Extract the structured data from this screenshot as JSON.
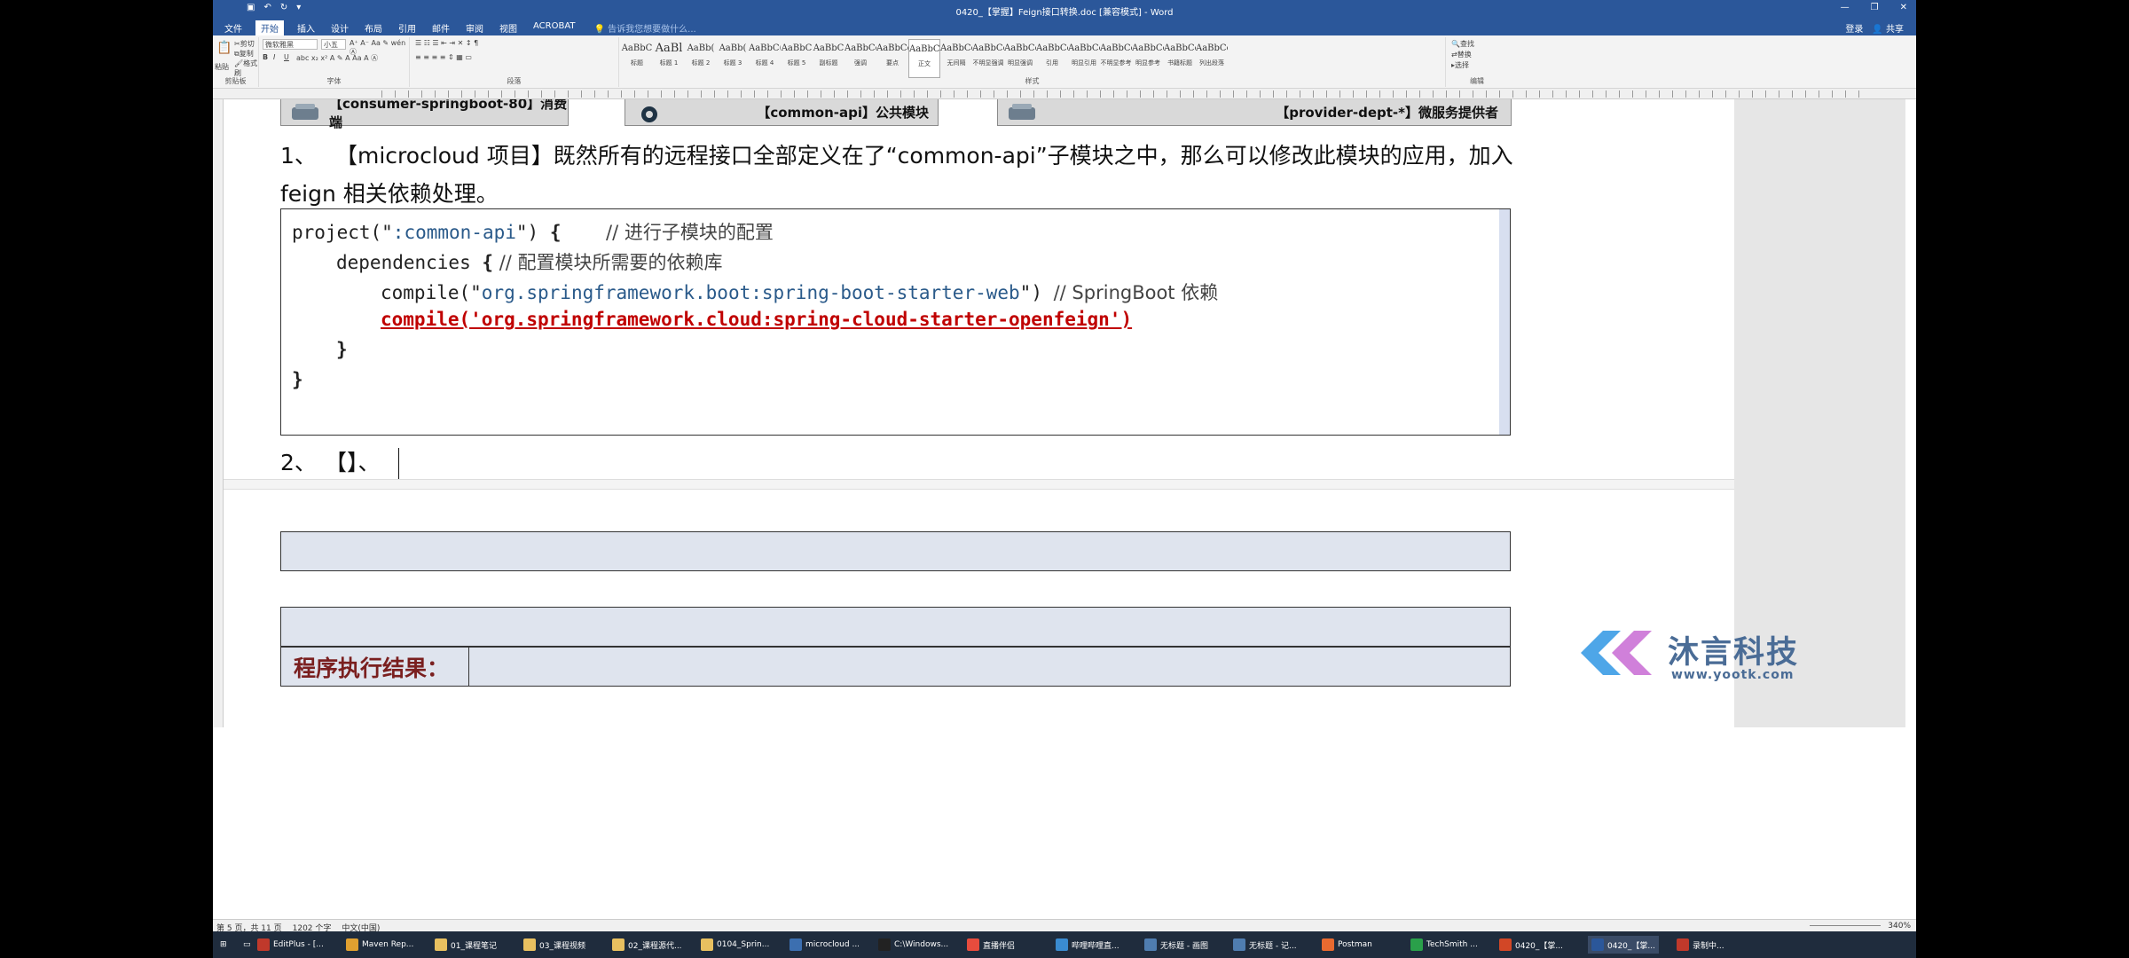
{
  "titlebar": {
    "title": "0420_【掌握】Feign接口转换.doc [兼容模式] - Word",
    "minimize": "—",
    "restore": "❐",
    "close": "✕"
  },
  "menu": {
    "tabs": [
      "文件",
      "开始",
      "插入",
      "设计",
      "布局",
      "引用",
      "邮件",
      "审阅",
      "视图",
      "ACROBAT"
    ],
    "active": "开始",
    "tellme": "告诉我您想要做什么...",
    "login": "登录",
    "share": "共享"
  },
  "ribbon": {
    "paste": "粘贴",
    "cut": "剪切",
    "copy": "复制",
    "format_painter": "格式刷",
    "font_name": "微软雅黑",
    "font_size": "小五",
    "groups": [
      "剪贴板",
      "字体",
      "段落",
      "样式",
      "编辑"
    ],
    "styles": [
      {
        "sample": "AaBbC",
        "name": "标题"
      },
      {
        "sample": "AaBl",
        "name": "标题 1"
      },
      {
        "sample": "AaBb(",
        "name": "标题 2"
      },
      {
        "sample": "AaBb(",
        "name": "标题 3"
      },
      {
        "sample": "AaBbC(",
        "name": "标题 4"
      },
      {
        "sample": "AaBbC",
        "name": "标题 5"
      },
      {
        "sample": "AaBbC",
        "name": "副标题"
      },
      {
        "sample": "AaBbCcDt",
        "name": "强调"
      },
      {
        "sample": "AaBbCcD",
        "name": "要点"
      },
      {
        "sample": "AaBbCcDc",
        "name": "正文"
      },
      {
        "sample": "AaBbCcDc",
        "name": "无间隔"
      },
      {
        "sample": "AaBbCcDc",
        "name": "不明显强调"
      },
      {
        "sample": "AaBbCcDc",
        "name": "明显强调"
      },
      {
        "sample": "AaBbCcDc",
        "name": "引用"
      },
      {
        "sample": "AaBbCcDc",
        "name": "明显引用"
      },
      {
        "sample": "AaBbCcD",
        "name": "不明显参考"
      },
      {
        "sample": "AaBbCcI",
        "name": "明显参考"
      },
      {
        "sample": "AaBbCcDi",
        "name": "书籍标题"
      },
      {
        "sample": "AaBbCcDc",
        "name": "列出段落"
      }
    ],
    "find": "查找",
    "replace": "替换",
    "select": "选择"
  },
  "document": {
    "modules": [
      {
        "label": "【consumer-springboot-80】消费端"
      },
      {
        "label": "【common-api】公共模块"
      },
      {
        "label": "【provider-dept-*】微服务提供者"
      }
    ],
    "para1_num": "1、",
    "para1_text": "【microcloud 项目】既然所有的远程接口全部定义在了“common-api”子模块之中，那么可以修改此模块的应用，加入feign 相关依赖处理。",
    "code": {
      "l1_a": "project(\"",
      "l1_str": ":common-api",
      "l1_b": "\") ",
      "l1_brace": "{",
      "l1_cmt": "// 进行子模块的配置",
      "l2_a": "dependencies ",
      "l2_brace": "{",
      "l2_cmt": " // 配置模块所需要的依赖库",
      "l3_a": "compile(\"",
      "l3_str": "org.springframework.boot:spring-boot-starter-web",
      "l3_b": "\") ",
      "l3_cmt": "// SpringBoot 依赖",
      "l4": "compile('org.springframework.cloud:spring-cloud-starter-openfeign')",
      "l5": "}",
      "l6": "}"
    },
    "para2_num": "2、",
    "para2_text": "【】、",
    "result_label": "程序执行结果："
  },
  "watermark": {
    "name": "沐言科技",
    "url": "www.yootk.com"
  },
  "status": {
    "page": "第 5 页，共 11 页",
    "words": "1202 个字",
    "lang": "中文(中国)",
    "zoom": "340%"
  },
  "taskbar": {
    "items": [
      "EditPlus - [...",
      "Maven Rep...",
      "01_课程笔记",
      "03_课程视频",
      "02_课程源代...",
      "0104_Sprin...",
      "microcloud ...",
      "C:\\Windows...",
      "直播伴侣",
      "哔哩哔哩直...",
      "无标题 - 画图",
      "无标题 - 记...",
      "Postman",
      "TechSmith ...",
      "0420_【掌...",
      "0420_【掌...",
      "录制中..."
    ]
  }
}
